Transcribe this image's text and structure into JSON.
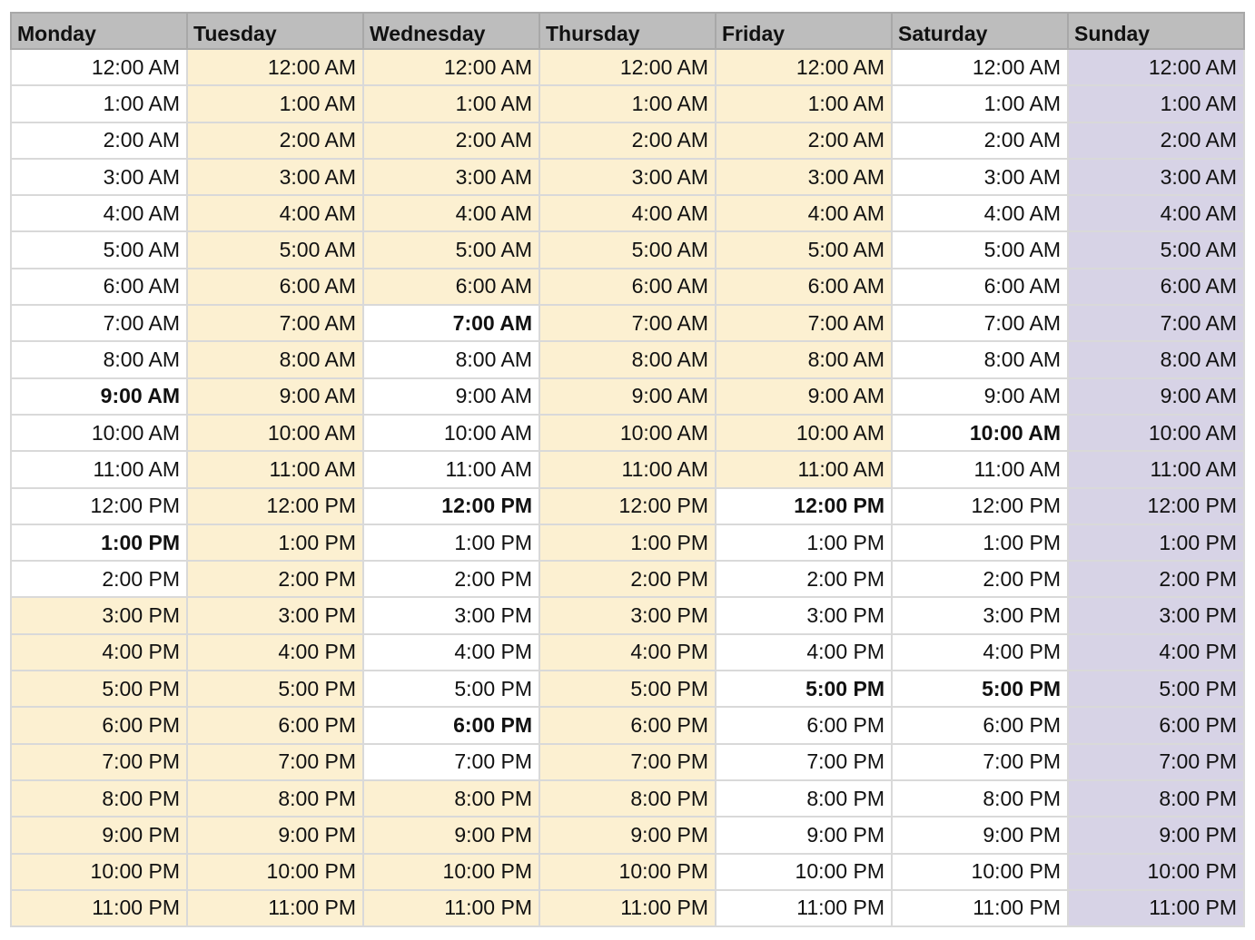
{
  "colors": {
    "header_bg": "#bdbdbd",
    "busy": "#fcf0d1",
    "sunday": "#d7d3e6",
    "free": "#ffffff",
    "grid_line": "#d9d9d9"
  },
  "days": [
    "Monday",
    "Tuesday",
    "Wednesday",
    "Thursday",
    "Friday",
    "Saturday",
    "Sunday"
  ],
  "times": [
    "12:00 AM",
    "1:00 AM",
    "2:00 AM",
    "3:00 AM",
    "4:00 AM",
    "5:00 AM",
    "6:00 AM",
    "7:00 AM",
    "8:00 AM",
    "9:00 AM",
    "10:00 AM",
    "11:00 AM",
    "12:00 PM",
    "1:00 PM",
    "2:00 PM",
    "3:00 PM",
    "4:00 PM",
    "5:00 PM",
    "6:00 PM",
    "7:00 PM",
    "8:00 PM",
    "9:00 PM",
    "10:00 PM",
    "11:00 PM"
  ],
  "highlight_legend": {
    "y": "yellow",
    "p": "purple",
    "w": "white"
  },
  "fills": [
    "wwwwwwwwwwwwwwwyyyyyyyyy",
    "yyyyyyyyyyyyyyyyyyyyyyyy",
    "yyyyyyywwwwwwwwwwwwwyyyy",
    "yyyyyyyyyyyyyyyyyyyyyyyy",
    "yyyyyyyyyyyywwwwwwwwwwww",
    "wwwwwwwwwwwwwwwwwwwwwwww",
    "pppppppppppppppppppppppp"
  ],
  "bold": [
    [
      9,
      13
    ],
    [],
    [
      7,
      12,
      18
    ],
    [],
    [
      12,
      17
    ],
    [
      10,
      17
    ],
    []
  ]
}
